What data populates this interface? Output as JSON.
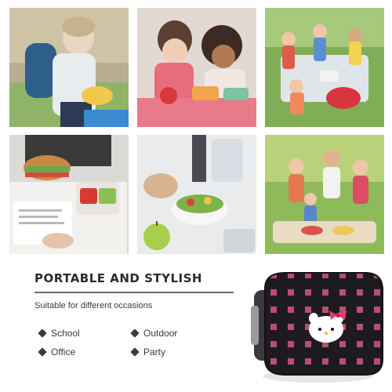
{
  "gallery": {
    "photos": [
      {
        "icon": "schoolboy-photo"
      },
      {
        "icon": "kids-lunch-table-photo"
      },
      {
        "icon": "kids-picnic-outdoor-photo"
      },
      {
        "icon": "office-lunch-photo"
      },
      {
        "icon": "salad-bowl-photo"
      },
      {
        "icon": "family-picnic-photo"
      }
    ]
  },
  "promo": {
    "title": "PORTABLE AND STYLISH",
    "subtitle": "Suitable for different occasions",
    "occasions": [
      "School",
      "Outdoor",
      "Office",
      "Party"
    ]
  },
  "product": {
    "icon": "lunch-bag-icon",
    "colors": {
      "bag": "#1e1b20",
      "pattern": "#d4577f",
      "bow": "#e23c6b"
    }
  },
  "colors": {
    "title": "#2b2b2b",
    "text": "#3a3a3a",
    "rule": "#6a6a6a"
  }
}
